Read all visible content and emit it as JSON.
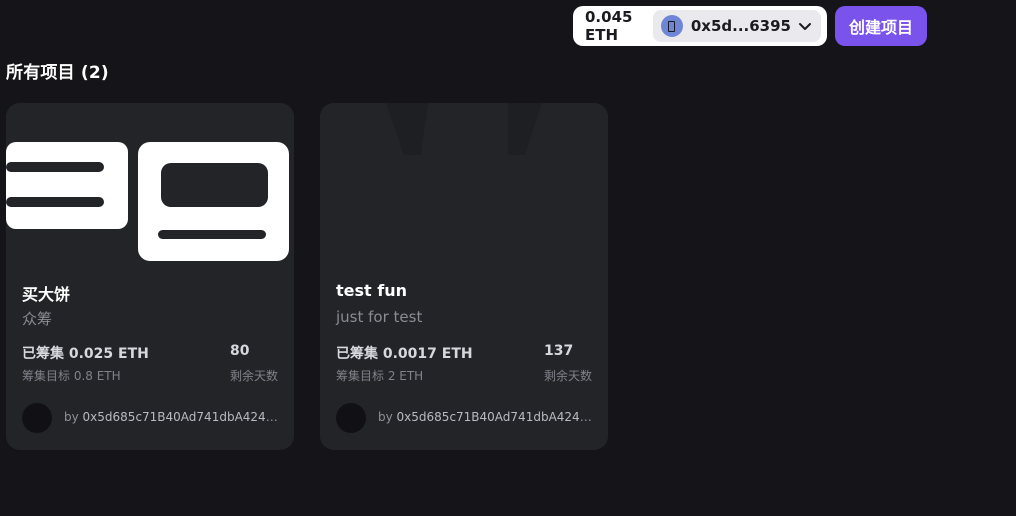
{
  "header": {
    "balance": "0.045 ETH",
    "address": "0x5d...6395",
    "create_button": "创建项目",
    "icons": {
      "wallet_avatar": "wallet-avatar-icon",
      "dropdown": "chevron-down-icon"
    },
    "colors": {
      "accent": "#7a52ec",
      "wallet_bg": "#ffffff"
    }
  },
  "section": {
    "title": "所有项目 (2)"
  },
  "projects": [
    {
      "title": "买大饼",
      "subtitle": "众筹",
      "raised": "已筹集 0.025 ETH",
      "goal": "筹集目标 0.8 ETH",
      "days": "80",
      "days_label": "剩余天数",
      "by": "by",
      "creator": "0x5d685c71B40Ad741dbA42422..."
    },
    {
      "title": "test fun",
      "subtitle": "just for test",
      "raised": "已筹集 0.0017 ETH",
      "goal": "筹集目标 2 ETH",
      "days": "137",
      "days_label": "剩余天数",
      "by": "by",
      "creator": "0x5d685c71B40Ad741dbA42422..."
    }
  ],
  "colors": {
    "background": "#151419",
    "card": "#232428"
  }
}
